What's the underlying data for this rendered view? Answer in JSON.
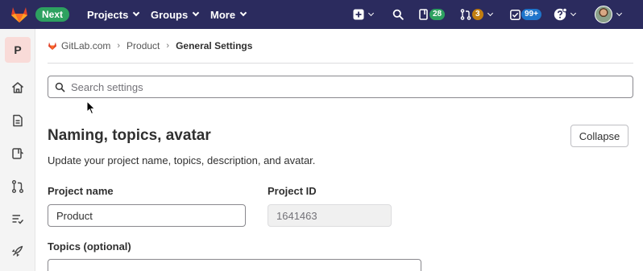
{
  "topbar": {
    "next_label": "Next",
    "menus": [
      {
        "label": "Projects"
      },
      {
        "label": "Groups"
      },
      {
        "label": "More"
      }
    ],
    "issues_count": "28",
    "merge_requests_count": "3",
    "todos_count": "99+",
    "icons": {
      "logo": "gitlab-tanuki-icon",
      "create": "plus-square-icon",
      "search": "search-icon",
      "issues": "issues-icon",
      "merge_requests": "merge-request-icon",
      "todos": "todo-check-icon",
      "help": "question-circle-icon",
      "user": "avatar"
    }
  },
  "sidebar": {
    "project_initial": "P",
    "items": [
      {
        "icon": "home-icon"
      },
      {
        "icon": "document-icon"
      },
      {
        "icon": "issues-icon"
      },
      {
        "icon": "merge-request-icon"
      },
      {
        "icon": "list-check-icon"
      },
      {
        "icon": "rocket-icon"
      }
    ]
  },
  "breadcrumb": {
    "items": [
      "GitLab.com",
      "Product",
      "General Settings"
    ]
  },
  "search": {
    "placeholder": "Search settings",
    "value": ""
  },
  "section": {
    "title": "Naming, topics, avatar",
    "collapse_label": "Collapse",
    "description": "Update your project name, topics, description, and avatar."
  },
  "form": {
    "project_name_label": "Project name",
    "project_name_value": "Product",
    "project_id_label": "Project ID",
    "project_id_value": "1641463",
    "topics_label": "Topics (optional)",
    "topics_value": ""
  },
  "colors": {
    "navbar": "#2b2b5e",
    "badge_green": "#2da160",
    "badge_orange": "#c17d10",
    "badge_blue": "#1f75cb"
  }
}
